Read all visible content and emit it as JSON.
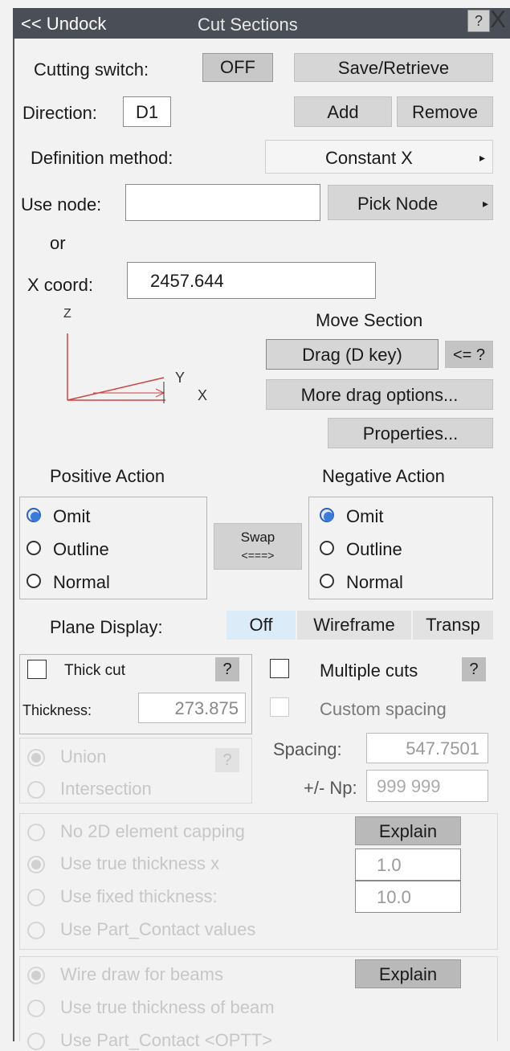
{
  "titlebar": {
    "undock_label": "<< Undock",
    "title": "Cut Sections",
    "help": "?",
    "close": "X"
  },
  "cutting": {
    "label": "Cutting switch:",
    "value": "OFF",
    "save_retrieve": "Save/Retrieve"
  },
  "direction": {
    "label": "Direction:",
    "value": "D1",
    "add": "Add",
    "remove": "Remove"
  },
  "definition": {
    "label": "Definition method:",
    "value": "Constant X",
    "arrow": "▸"
  },
  "use_node": {
    "label": "Use node:",
    "value": "",
    "pick": "Pick Node",
    "arrow": "▸"
  },
  "or_label": "or",
  "xcoord": {
    "label": "X coord:",
    "value": "2457.644"
  },
  "axes": {
    "z": "Z",
    "y": "Y",
    "x": "X"
  },
  "move": {
    "title": "Move Section",
    "drag": "Drag (D key)",
    "drag_help": "<= ?",
    "more": "More drag options...",
    "properties": "Properties..."
  },
  "positive": {
    "title": "Positive Action",
    "options": [
      "Omit",
      "Outline",
      "Normal"
    ],
    "selected": "Omit"
  },
  "negative": {
    "title": "Negative Action",
    "options": [
      "Omit",
      "Outline",
      "Normal"
    ],
    "selected": "Omit"
  },
  "swap": {
    "line1": "Swap",
    "line2": "<===>"
  },
  "plane": {
    "label": "Plane Display:",
    "options": [
      "Off",
      "Wireframe",
      "Transp"
    ],
    "selected": "Off"
  },
  "thick": {
    "label": "Thick cut",
    "help": "?",
    "thickness_label": "Thickness:",
    "thickness_value": "273.875"
  },
  "multi": {
    "label": "Multiple cuts",
    "help": "?",
    "custom": "Custom spacing",
    "spacing_label": "Spacing:",
    "spacing_value": "547.7501",
    "np_label": "+/- Np:",
    "np_value": "999  999"
  },
  "boolean": {
    "options": [
      "Union",
      "Intersection"
    ],
    "help": "?"
  },
  "capping": {
    "options": [
      "No 2D element capping",
      "Use true thickness  x",
      "Use fixed thickness:",
      "Use Part_Contact values"
    ],
    "explain": "Explain",
    "scale": "1.0",
    "fixed": "10.0"
  },
  "beams": {
    "options": [
      "Wire draw for beams",
      "Use true thickness of beam",
      "Use Part_Contact <OPTT>"
    ],
    "explain": "Explain"
  },
  "colors": {
    "title_bg": "#4a4e57",
    "radio_on": "#3a7ad8",
    "seg_selected": "#dcebf8"
  }
}
